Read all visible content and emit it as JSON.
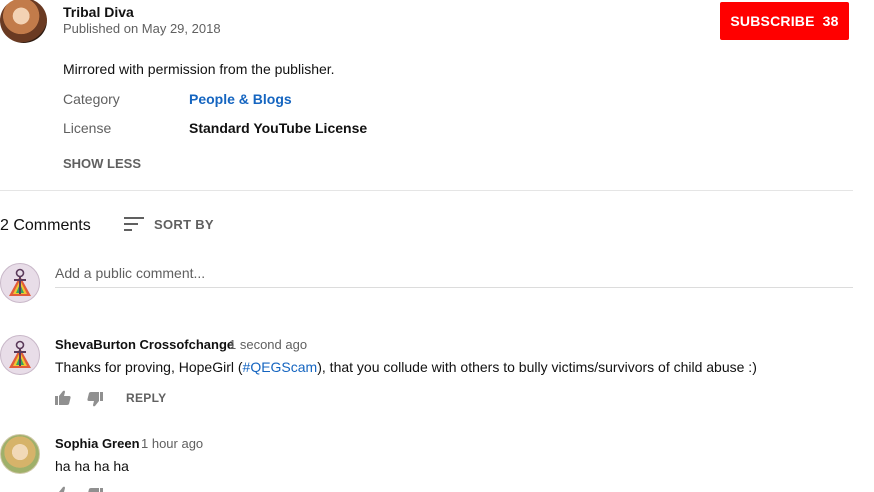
{
  "channel": {
    "name": "Tribal Diva",
    "published": "Published on May 29, 2018",
    "subscribe_label": "SUBSCRIBE",
    "subscriber_count": "38"
  },
  "description": {
    "text": "Mirrored with permission from the publisher.",
    "category_label": "Category",
    "category_value": "People & Blogs",
    "license_label": "License",
    "license_value": "Standard YouTube License",
    "show_less": "SHOW LESS"
  },
  "comments_header": {
    "count_label": "2 Comments",
    "sort_label": "SORT BY"
  },
  "comment_box": {
    "placeholder": "Add a public comment..."
  },
  "comments": [
    {
      "author": "ShevaBurton Crossofchange",
      "time": "1 second ago",
      "text_before": "Thanks for proving, HopeGirl (",
      "hashtag": "#QEGScam",
      "text_after": "), that you collude with others to bully victims/survivors of child abuse :)",
      "reply_label": "REPLY"
    },
    {
      "author": "Sophia Green",
      "time": "1 hour ago",
      "text": "ha ha ha ha"
    }
  ],
  "colors": {
    "subscribe": "#ff0000",
    "link": "#1565c0",
    "secondary_text": "#606060"
  },
  "icons": [
    "sort-icon",
    "thumbs-up-icon",
    "thumbs-down-icon"
  ]
}
